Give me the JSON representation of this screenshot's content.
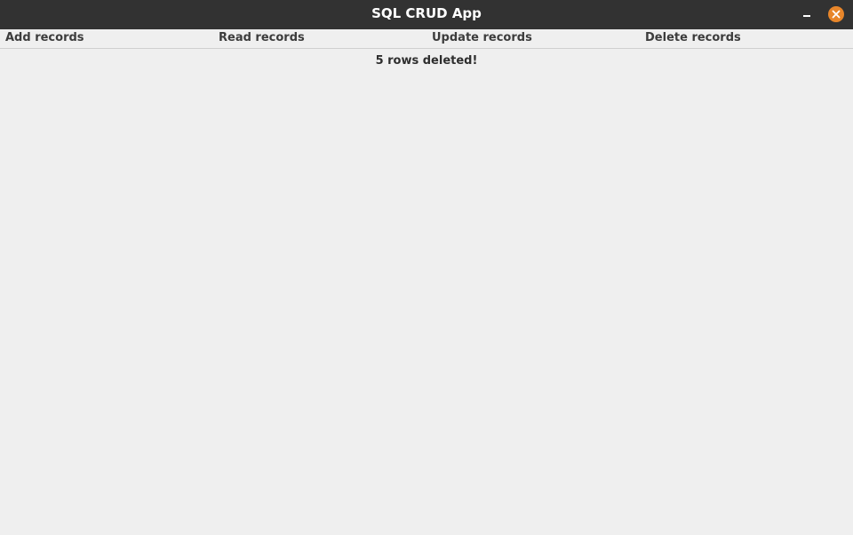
{
  "window": {
    "title": "SQL CRUD App"
  },
  "menu": {
    "add_label": "Add records",
    "read_label": "Read records",
    "update_label": "Update records",
    "delete_label": "Delete records"
  },
  "status": {
    "message": "5 rows deleted!"
  },
  "colors": {
    "titlebar": "#323232",
    "close_button": "#e8862a",
    "background": "#efefef"
  },
  "icons": {
    "minimize": "minimize-icon",
    "close": "close-icon"
  }
}
